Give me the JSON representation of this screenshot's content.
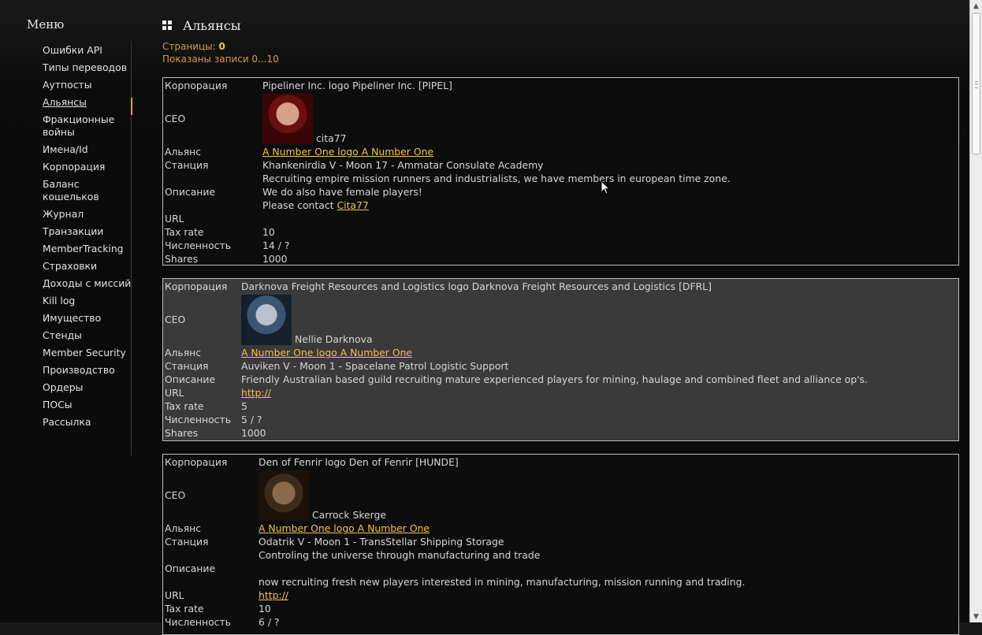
{
  "sidebar": {
    "title": "Меню",
    "items": [
      {
        "label": "Ошибки API"
      },
      {
        "label": "Типы переводов"
      },
      {
        "label": "Аутпосты"
      },
      {
        "label": "Альянсы"
      },
      {
        "label": "Фракционные войны"
      },
      {
        "label": "Имена/Id"
      },
      {
        "label": "Корпорация"
      },
      {
        "label": "Баланс кошельков"
      },
      {
        "label": "Журнал"
      },
      {
        "label": "Транзакции"
      },
      {
        "label": "MemberTracking"
      },
      {
        "label": "Страховки"
      },
      {
        "label": "Доходы с миссий"
      },
      {
        "label": "Kill log"
      },
      {
        "label": "Имущество"
      },
      {
        "label": "Стенды"
      },
      {
        "label": "Member Security"
      },
      {
        "label": "Производство"
      },
      {
        "label": "Ордеры"
      },
      {
        "label": "ПОСы"
      },
      {
        "label": "Рассылка"
      }
    ],
    "active_index": 3
  },
  "page": {
    "title": "Альянсы",
    "pages_label": "Страницы:",
    "pages_value": "0",
    "records_label": "Показаны записи 0...10"
  },
  "labels": {
    "corporation": "Корпорация",
    "ceo": "CEO",
    "alliance": "Альянс",
    "station": "Станция",
    "description": "Описание",
    "url": "URL",
    "tax_rate": "Tax rate",
    "members": "Численность",
    "shares": "Shares"
  },
  "corps": [
    {
      "corporation": "Pipeliner Inc. logo Pipeliner Inc. [PIPEL]",
      "ceo": "cita77",
      "alliance": "A Number One logo A Number One",
      "station": "Khankenirdia V - Moon 17 - Ammatar Consulate Academy",
      "description_lines": [
        "Recruiting empire mission runners and industrialists, we have members in european time zone.",
        "We do also have female players!"
      ],
      "description_contact": "Please contact",
      "description_link": "Cita77",
      "url": "",
      "tax_rate": "10",
      "members": "14 / ?",
      "shares": "1000"
    },
    {
      "corporation": "Darknova Freight Resources and Logistics logo Darknova Freight Resources and Logistics [DFRL]",
      "ceo": "Nellie Darknova",
      "alliance": "A Number One logo A Number One",
      "station": "Auviken V - Moon 1 - Spacelane Patrol Logistic Support",
      "description": "Friendly Australian based guild recruiting mature experienced players for mining, haulage and combined fleet and alliance op's.",
      "url": "http://",
      "tax_rate": "5",
      "members": "5 / ?",
      "shares": "1000"
    },
    {
      "corporation": "Den of Fenrir logo Den of Fenrir [HUNDE]",
      "ceo": "Carrock Skerge",
      "alliance": "A Number One logo A Number One",
      "station": "Odatrik V - Moon 1 - TransStellar Shipping Storage",
      "description_line1": "Controling the universe through manufacturing and trade",
      "description_line2": "now recruiting fresh new players interested in mining, manufacturing, mission running and trading.",
      "url": "http://",
      "tax_rate": "10",
      "members": "6 / ?"
    }
  ],
  "colors": {
    "accent": "#f2c14e",
    "meta_text": "#d39a4c",
    "alt_card_bg": "#3a3a3a",
    "card_border": "#bdbdbd"
  }
}
